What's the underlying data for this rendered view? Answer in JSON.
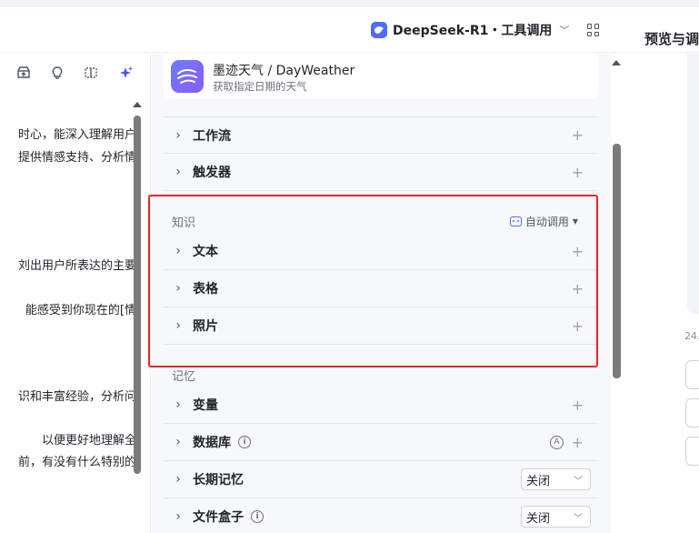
{
  "header": {
    "model_label": "DeepSeek-R1・工具调用",
    "right_title": "预览与调"
  },
  "left": {
    "lines": [
      "时心，能深入理解用户",
      "提供情感支持、分析情",
      "刘出用户所表达的主要",
      "能感受到你现在的[情",
      "识和丰富经验，分析问",
      "以便更好地理解全",
      "前，有没有什么特别的"
    ]
  },
  "plugin": {
    "name": "墨迹天气 / DayWeather",
    "desc": "获取指定日期的天气"
  },
  "skills": {
    "workflow": "工作流",
    "trigger": "触发器"
  },
  "knowledge": {
    "title": "知识",
    "auto_call": "自动调用",
    "text": "文本",
    "table": "表格",
    "photo": "照片"
  },
  "memory": {
    "title": "记忆",
    "variable": "变量",
    "database": "数据库",
    "long_term": "长期记忆",
    "long_term_value": "关闭",
    "file_box": "文件盒子",
    "file_box_value": "关闭"
  },
  "right": {
    "timestamp": "24."
  },
  "icons": {
    "plus": "+",
    "chevron": "›"
  }
}
